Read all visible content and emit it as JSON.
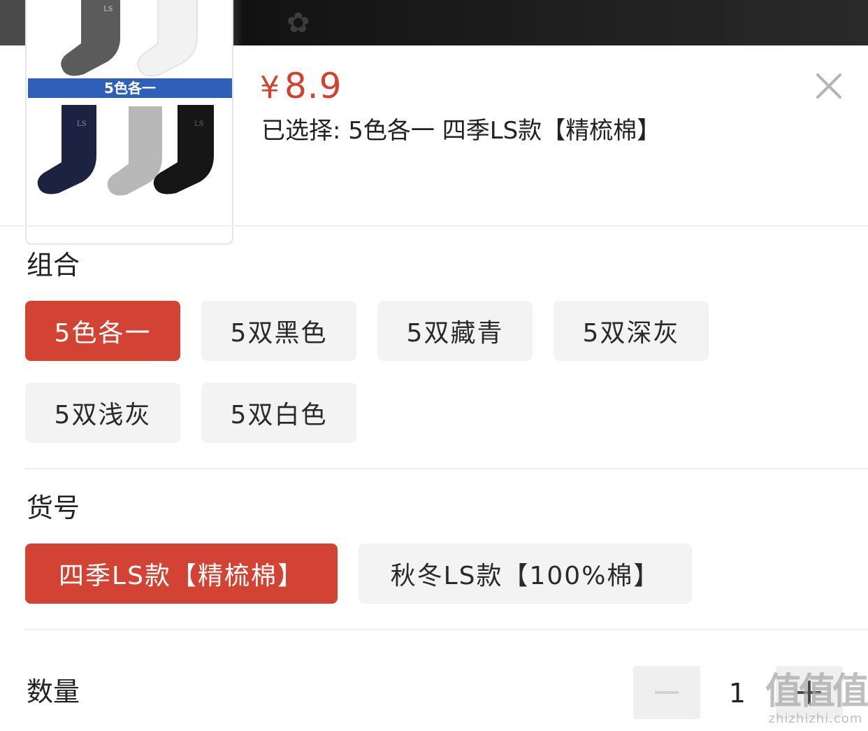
{
  "product": {
    "price_symbol": "¥",
    "price_value": "8.9",
    "selected_text": "已选择: 5色各一 四季LS款【精梳棉】",
    "thumbnail_banner": "5色各一",
    "sock_logo": "LS"
  },
  "combo": {
    "title": "组合",
    "options": [
      {
        "label": "5色各一",
        "selected": true
      },
      {
        "label": "5双黑色",
        "selected": false
      },
      {
        "label": "5双藏青",
        "selected": false
      },
      {
        "label": "5双深灰",
        "selected": false
      },
      {
        "label": "5双浅灰",
        "selected": false
      },
      {
        "label": "5双白色",
        "selected": false
      }
    ]
  },
  "item_no": {
    "title": "货号",
    "options": [
      {
        "label": "四季LS款【精梳棉】",
        "selected": true
      },
      {
        "label": "秋冬LS款【100%棉】",
        "selected": false
      }
    ]
  },
  "quantity": {
    "title": "数量",
    "value": "1"
  },
  "watermark": {
    "main": "值值值",
    "sub": "zhizhizhi.com"
  },
  "colors": {
    "accent": "#d34334",
    "price": "#d2412e",
    "chip_bg": "#f3f3f3",
    "banner": "#2f5fb8"
  },
  "icons": [
    "close-icon",
    "minus-icon",
    "plus-icon"
  ]
}
